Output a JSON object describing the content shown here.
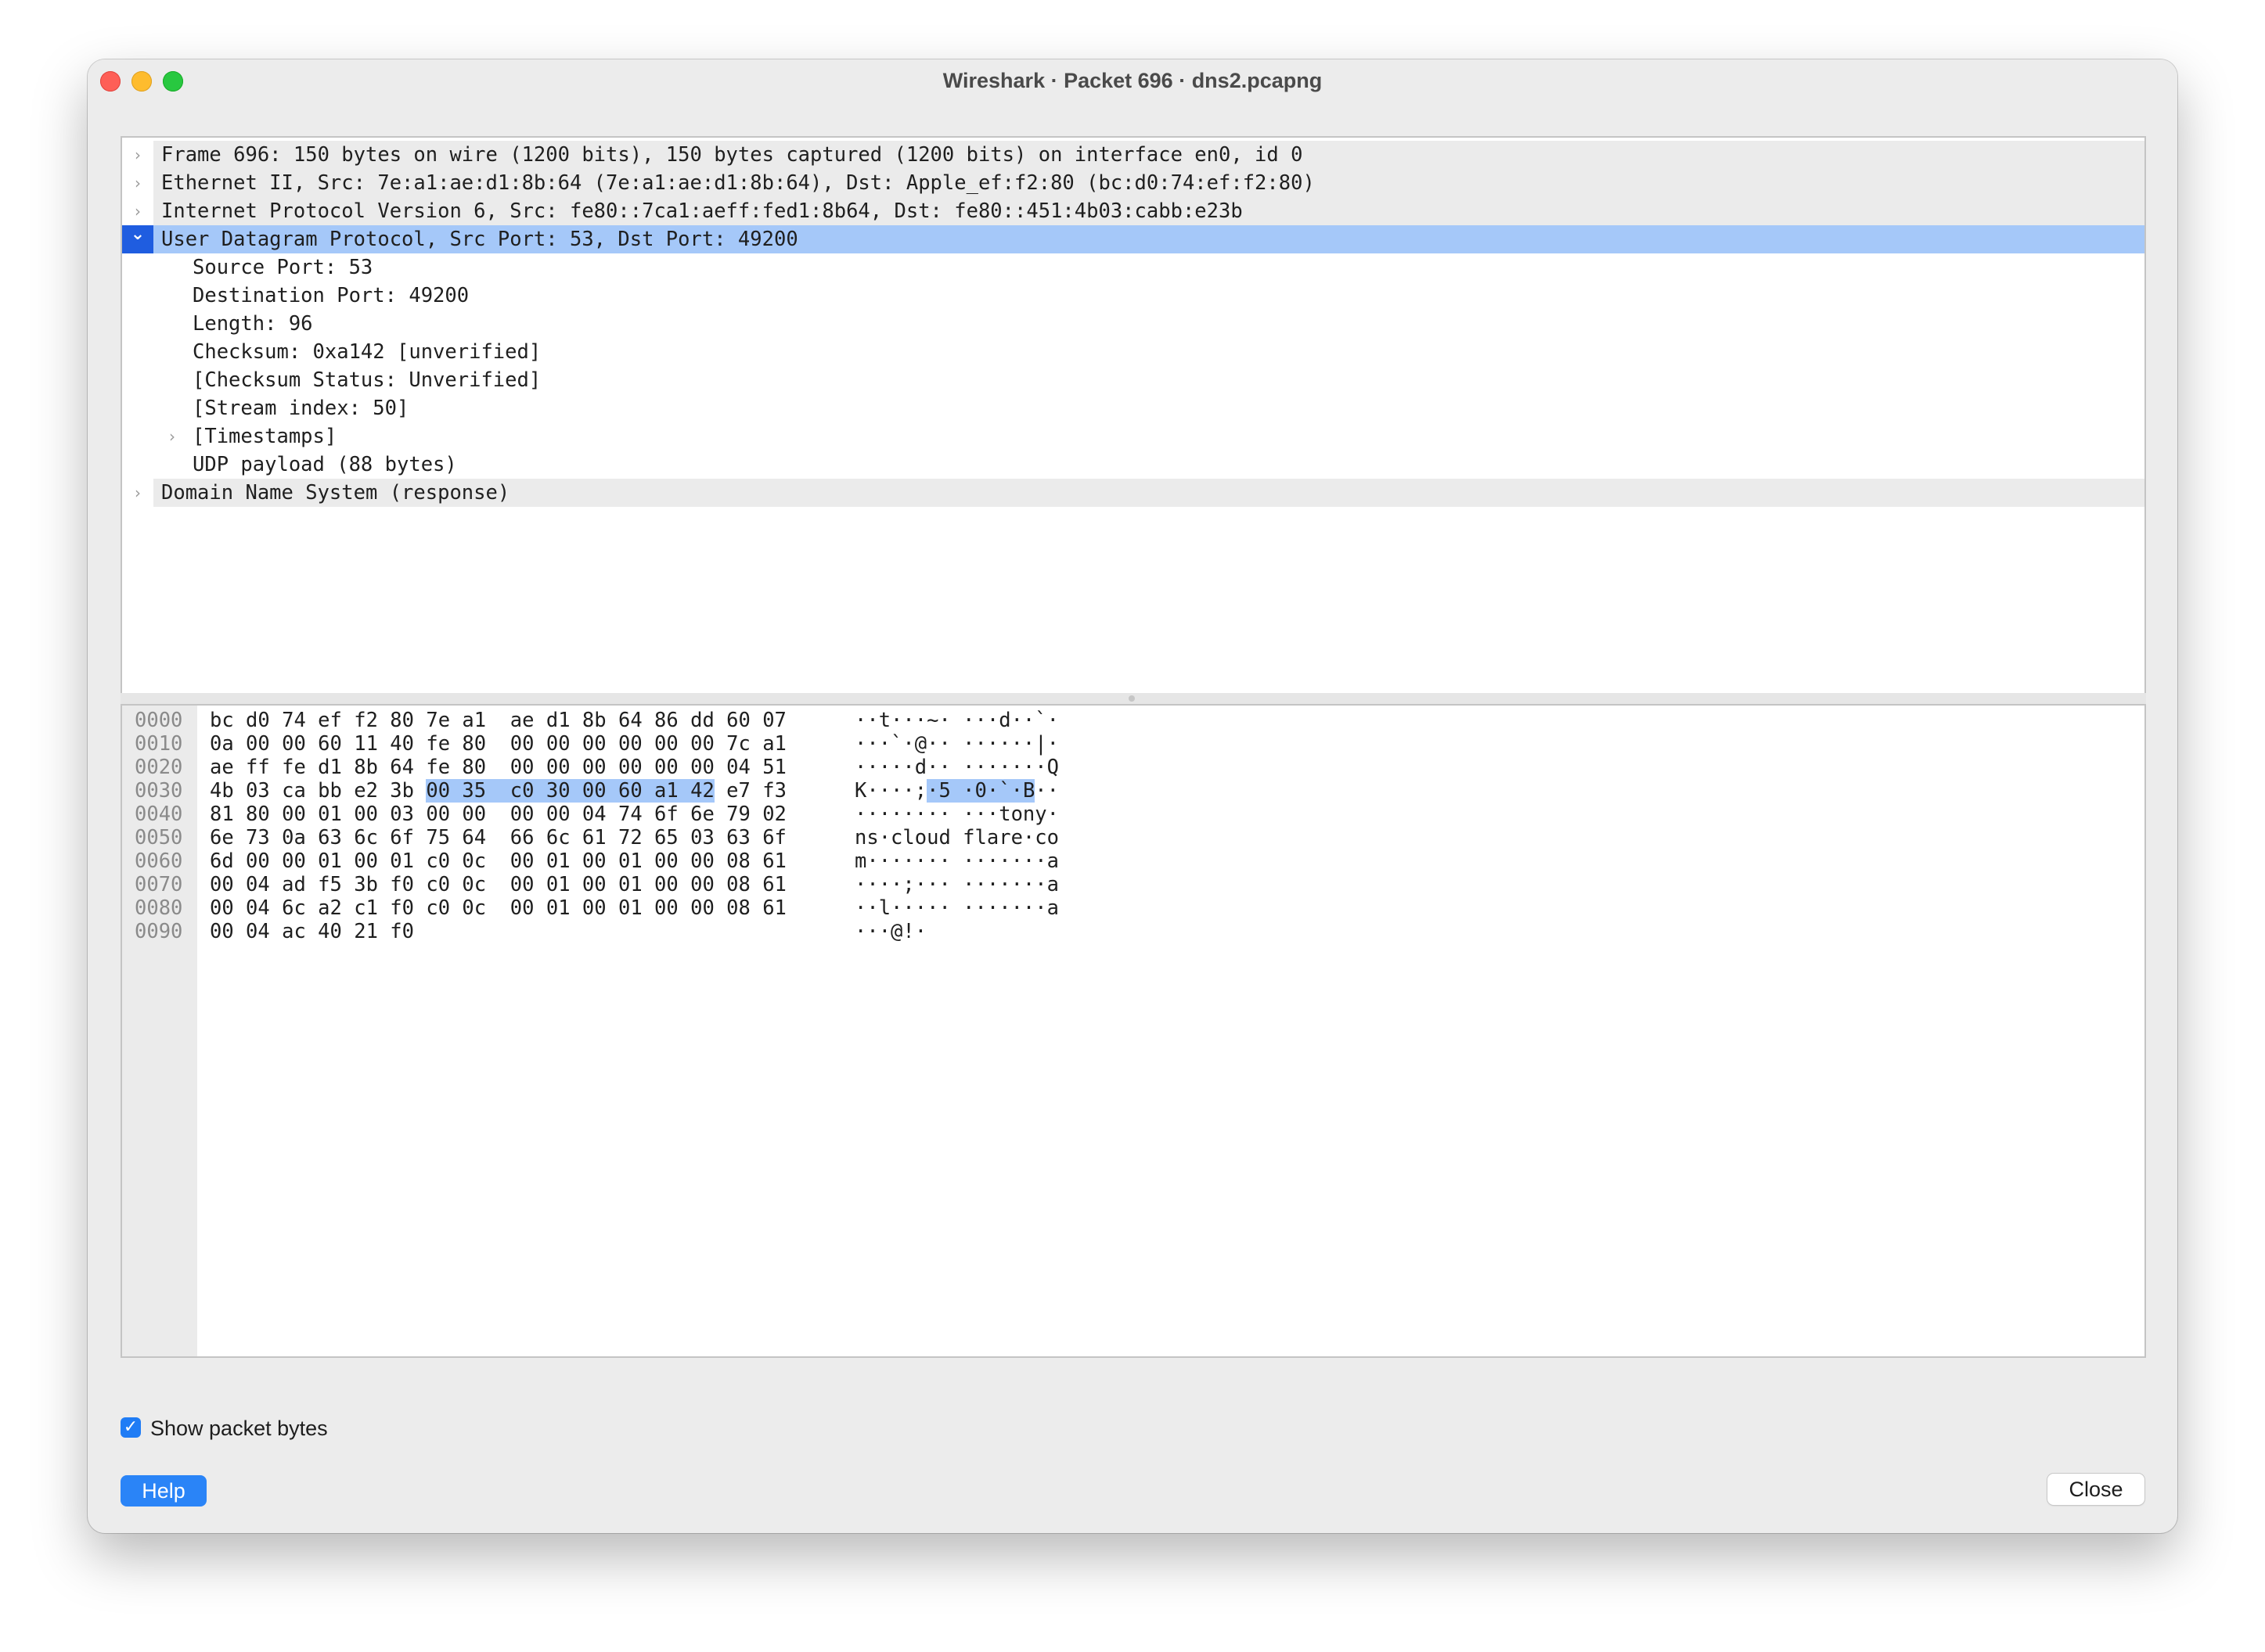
{
  "window": {
    "title": "Wireshark · Packet 696 · dns2.pcapng"
  },
  "tree": {
    "rows": [
      {
        "text": "Frame 696: 150 bytes on wire (1200 bits), 150 bytes captured (1200 bits) on interface en0, id 0",
        "expander": "chevron-right-icon"
      },
      {
        "text": "Ethernet II, Src: 7e:a1:ae:d1:8b:64 (7e:a1:ae:d1:8b:64), Dst: Apple_ef:f2:80 (bc:d0:74:ef:f2:80)",
        "expander": "chevron-right-icon"
      },
      {
        "text": "Internet Protocol Version 6, Src: fe80::7ca1:aeff:fed1:8b64, Dst: fe80::451:4b03:cabb:e23b",
        "expander": "chevron-right-icon"
      },
      {
        "text": "User Datagram Protocol, Src Port: 53, Dst Port: 49200",
        "expander": "chevron-down-icon",
        "selected": true
      },
      {
        "text": "Source Port: 53"
      },
      {
        "text": "Destination Port: 49200"
      },
      {
        "text": "Length: 96"
      },
      {
        "text": "Checksum: 0xa142 [unverified]"
      },
      {
        "text": "[Checksum Status: Unverified]"
      },
      {
        "text": "[Stream index: 50]"
      },
      {
        "text": "[Timestamps]",
        "expander": "chevron-right-icon"
      },
      {
        "text": "UDP payload (88 bytes)"
      },
      {
        "text": "Domain Name System (response)",
        "expander": "chevron-right-icon"
      }
    ]
  },
  "bytes": {
    "highlight_color": "#a5c8f9",
    "rows": [
      {
        "offset": "0000",
        "hex_a": "bc d0 74 ef f2 80 7e a1  ae d1 8b 64 86 dd 60 07",
        "hex_hl": "",
        "hex_b": "",
        "ascii_a": "··t···~· ···d··`·",
        "ascii_hl": "",
        "ascii_b": ""
      },
      {
        "offset": "0010",
        "hex_a": "0a 00 00 60 11 40 fe 80  00 00 00 00 00 00 7c a1",
        "hex_hl": "",
        "hex_b": "",
        "ascii_a": "···`·@·· ······|·",
        "ascii_hl": "",
        "ascii_b": ""
      },
      {
        "offset": "0020",
        "hex_a": "ae ff fe d1 8b 64 fe 80  00 00 00 00 00 00 04 51",
        "hex_hl": "",
        "hex_b": "",
        "ascii_a": "·····d·· ·······Q",
        "ascii_hl": "",
        "ascii_b": ""
      },
      {
        "offset": "0030",
        "hex_a": "4b 03 ca bb e2 3b ",
        "hex_hl": "00 35  c0 30 00 60 a1 42",
        "hex_b": " e7 f3",
        "ascii_a": "K····;",
        "ascii_hl": "·5 ·0·`·B",
        "ascii_b": "··"
      },
      {
        "offset": "0040",
        "hex_a": "81 80 00 01 00 03 00 00  00 00 04 74 6f 6e 79 02",
        "hex_hl": "",
        "hex_b": "",
        "ascii_a": "········ ···tony·",
        "ascii_hl": "",
        "ascii_b": ""
      },
      {
        "offset": "0050",
        "hex_a": "6e 73 0a 63 6c 6f 75 64  66 6c 61 72 65 03 63 6f",
        "hex_hl": "",
        "hex_b": "",
        "ascii_a": "ns·cloud flare·co",
        "ascii_hl": "",
        "ascii_b": ""
      },
      {
        "offset": "0060",
        "hex_a": "6d 00 00 01 00 01 c0 0c  00 01 00 01 00 00 08 61",
        "hex_hl": "",
        "hex_b": "",
        "ascii_a": "m······· ·······a",
        "ascii_hl": "",
        "ascii_b": ""
      },
      {
        "offset": "0070",
        "hex_a": "00 04 ad f5 3b f0 c0 0c  00 01 00 01 00 00 08 61",
        "hex_hl": "",
        "hex_b": "",
        "ascii_a": "····;··· ·······a",
        "ascii_hl": "",
        "ascii_b": ""
      },
      {
        "offset": "0080",
        "hex_a": "00 04 6c a2 c1 f0 c0 0c  00 01 00 01 00 00 08 61",
        "hex_hl": "",
        "hex_b": "",
        "ascii_a": "··l····· ·······a",
        "ascii_hl": "",
        "ascii_b": ""
      },
      {
        "offset": "0090",
        "hex_a": "00 04 ac 40 21 f0",
        "hex_hl": "",
        "hex_b": "",
        "ascii_a": "···@!·",
        "ascii_hl": "",
        "ascii_b": ""
      }
    ]
  },
  "footer": {
    "show_packet_bytes": {
      "label": "Show packet bytes",
      "checked": true
    },
    "help_label": "Help",
    "close_label": "Close"
  },
  "colors": {
    "selection": "#a5c8f9",
    "selection_marker": "#1f5de0",
    "accent": "#2a84f7"
  }
}
